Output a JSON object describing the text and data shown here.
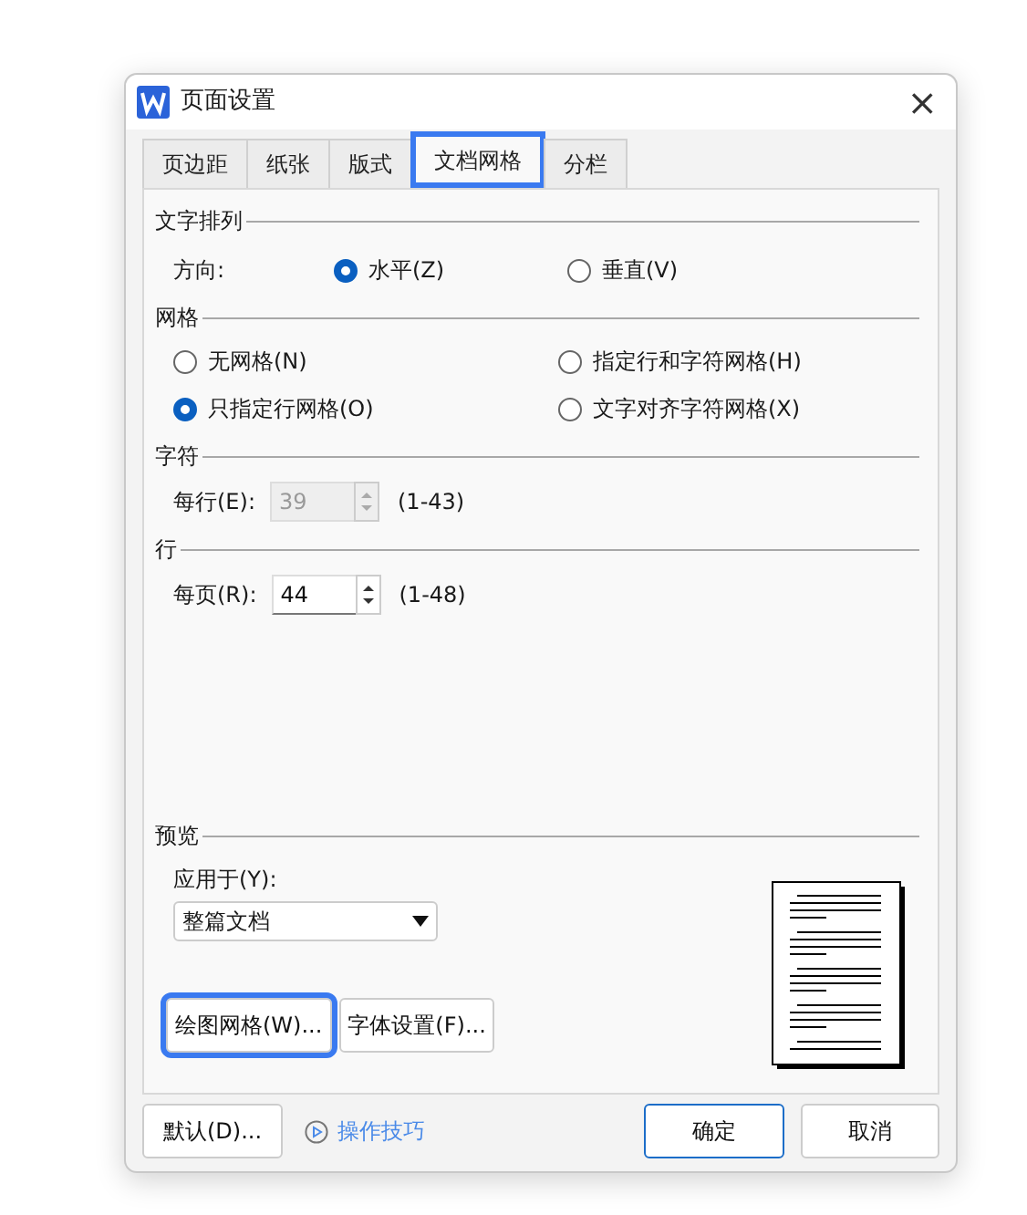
{
  "window": {
    "title": "页面设置",
    "close": "×"
  },
  "tabs": [
    {
      "label": "页边距",
      "selected": false
    },
    {
      "label": "纸张",
      "selected": false
    },
    {
      "label": "版式",
      "selected": false
    },
    {
      "label": "文档网格",
      "selected": true
    },
    {
      "label": "分栏",
      "selected": false
    }
  ],
  "direction": {
    "heading": "文字排列",
    "label": "方向:",
    "options": [
      {
        "label": "水平(Z)",
        "selected": true
      },
      {
        "label": "垂直(V)",
        "selected": false
      }
    ]
  },
  "grid": {
    "heading": "网格",
    "options": [
      {
        "label": "无网格(N)",
        "selected": false
      },
      {
        "label": "指定行和字符网格(H)",
        "selected": false
      },
      {
        "label": "只指定行网格(O)",
        "selected": true
      },
      {
        "label": "文字对齐字符网格(X)",
        "selected": false
      }
    ]
  },
  "spinners": [
    {
      "heading": "字符",
      "label": "每行(E):",
      "value": "39",
      "range": "(1-43)",
      "disabled": true
    },
    {
      "heading": "行",
      "label": "每页(R):",
      "value": "44",
      "range": "(1-48)",
      "disabled": false
    }
  ],
  "preview": {
    "heading": "预览",
    "apply_label": "应用于(Y):",
    "apply_value": "整篇文档"
  },
  "panel_buttons": [
    {
      "label": "绘图网格(W)...",
      "highlighted": true
    },
    {
      "label": "字体设置(F)...",
      "highlighted": false
    }
  ],
  "footer": {
    "default_button": "默认(D)...",
    "tips_link": "操作技巧",
    "ok": "确定",
    "cancel": "取消"
  }
}
